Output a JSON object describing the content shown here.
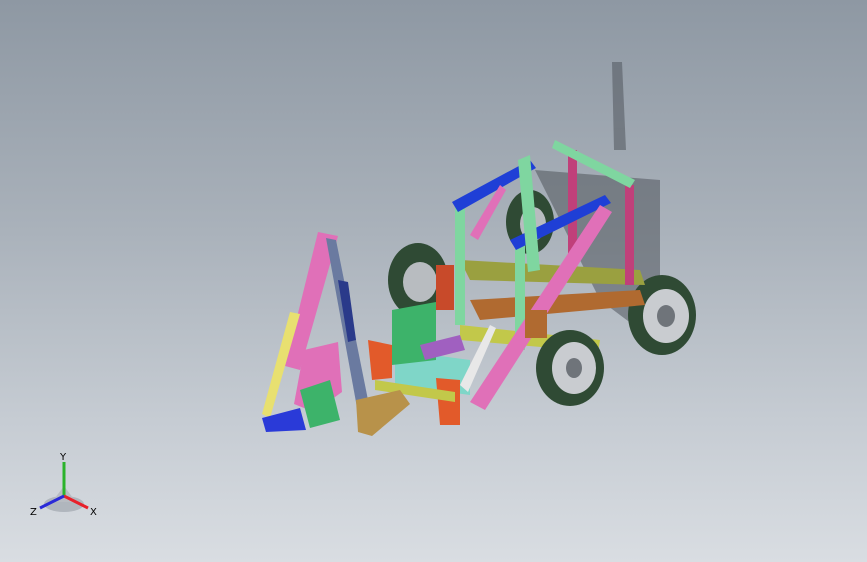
{
  "triad": {
    "x_label": "X",
    "y_label": "Y",
    "z_label": "Z",
    "x_color": "#e8202a",
    "y_color": "#2bb32b",
    "z_color": "#2a2ad8"
  },
  "model": {
    "frame_blue": "#1f3fd6",
    "frame_green": "#7fd6a0",
    "frame_pink": "#e070b8",
    "frame_olive": "#9aa040",
    "tire_color": "#3a5a3a",
    "shadow_color": "#4a4f55"
  }
}
